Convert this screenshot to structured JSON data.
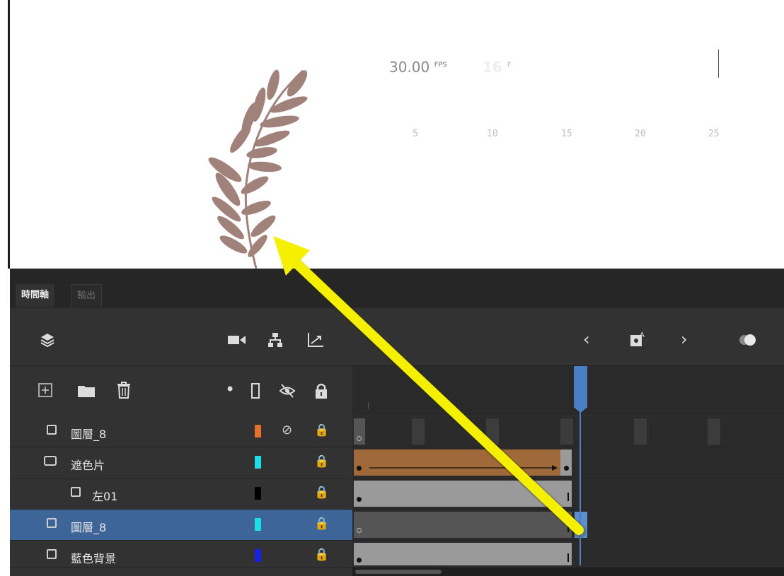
{
  "panel": {
    "tabs": [
      {
        "label": "時間軸",
        "active": true
      },
      {
        "label": "輸出",
        "active": false
      }
    ]
  },
  "toolbar": {
    "fps_value": "30.00",
    "fps_unit": "FPS",
    "current_frame": "16",
    "frame_unit": "F",
    "icons": [
      "layers-icon",
      "camera-icon",
      "hierarchy-icon",
      "graph-icon",
      "prev-frame-icon",
      "insert-keyframe-icon",
      "next-frame-icon",
      "onion-skin-icon"
    ]
  },
  "layer_header": {
    "icons": [
      "add-layer-icon",
      "folder-icon",
      "delete-icon",
      "dot-icon",
      "outline-icon",
      "hide-icon",
      "lock-icon"
    ]
  },
  "ruler": {
    "labels": [
      "5",
      "10",
      "15",
      "20",
      "25"
    ]
  },
  "layers": [
    {
      "name": "圖層_8",
      "color": "#e8702a",
      "hidden": true,
      "locked": true,
      "selected": false,
      "type": "normal"
    },
    {
      "name": "遮色片",
      "color": "#19e0e6",
      "hidden": false,
      "locked": true,
      "selected": false,
      "type": "mask"
    },
    {
      "name": "左01",
      "color": "#000000",
      "hidden": false,
      "locked": true,
      "selected": false,
      "type": "masked"
    },
    {
      "name": "圖層_8",
      "color": "#19e0e6",
      "hidden": false,
      "locked": true,
      "selected": true,
      "type": "normal"
    },
    {
      "name": "藍色背景",
      "color": "#1622e6",
      "hidden": false,
      "locked": true,
      "selected": false,
      "type": "normal"
    }
  ],
  "colors": {
    "accent": "#4a7fc4",
    "tween": "#a0693a",
    "arrow": "#f5f000",
    "leaf": "#a1827b"
  }
}
